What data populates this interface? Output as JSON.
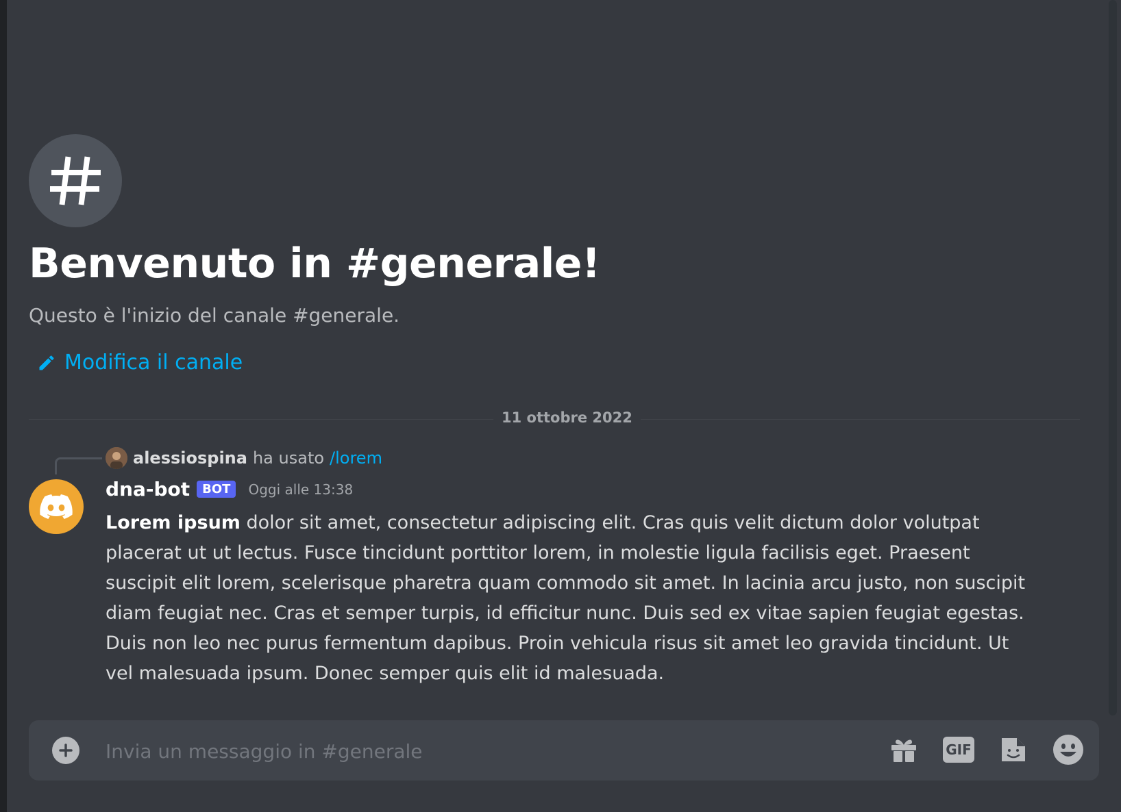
{
  "channel": {
    "welcome_title": "Benvenuto in #generale!",
    "welcome_subtitle": "Questo è l'inizio del canale #generale.",
    "edit_label": "Modifica il canale"
  },
  "divider": {
    "date": "11 ottobre 2022"
  },
  "reply": {
    "user": "alessiospina",
    "text": "ha usato",
    "command": "/lorem"
  },
  "message": {
    "author": "dna-bot",
    "badge": "BOT",
    "timestamp": "Oggi alle 13:38",
    "bold": "Lorem ipsum",
    "text": " dolor sit amet, consectetur adipiscing elit. Cras quis velit dictum dolor volutpat placerat ut ut lectus. Fusce tincidunt porttitor lorem, in molestie ligula facilisis eget. Praesent suscipit elit lorem, scelerisque pharetra quam commodo sit amet. In lacinia arcu justo, non suscipit diam feugiat nec. Cras et semper turpis, id efficitur nunc. Duis sed ex vitae sapien feugiat egestas. Duis non leo nec purus fermentum dapibus. Proin vehicula risus sit amet leo gravida tincidunt. Ut vel malesuada ipsum. Donec semper quis elit id malesuada."
  },
  "composer": {
    "placeholder": "Invia un messaggio in #generale",
    "gif_label": "GIF"
  },
  "icons": [
    "hash-icon",
    "pencil-icon",
    "discord-logo-icon",
    "plus-icon",
    "gift-icon",
    "gif-icon",
    "sticker-icon",
    "emoji-icon"
  ],
  "colors": {
    "background": "#36393f",
    "link": "#00aff4",
    "bot_badge": "#5865f2",
    "bot_avatar": "#f0a732"
  }
}
